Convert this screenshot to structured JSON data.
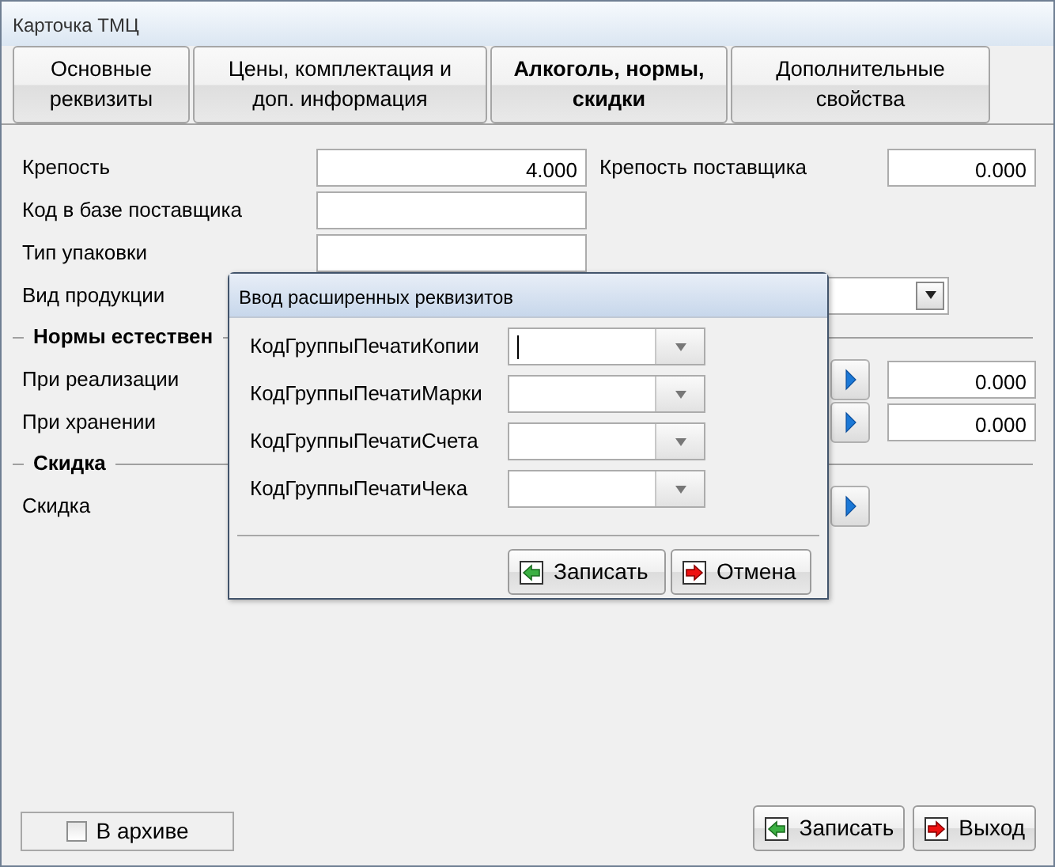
{
  "window": {
    "title": "Карточка ТМЦ"
  },
  "tabs": [
    {
      "label": "Основные реквизиты",
      "selected": false
    },
    {
      "label": "Цены, комплектация и доп.  информация",
      "selected": false
    },
    {
      "label": "Алкоголь, нормы, скидки",
      "selected": true
    },
    {
      "label": "Дополнительные свойства",
      "selected": false
    }
  ],
  "form": {
    "rows": [
      {
        "kind": "number",
        "label": "Крепость",
        "value": "4.000",
        "side": {
          "label": "Крепость поставщика",
          "value": "0.000"
        }
      },
      {
        "kind": "text",
        "label": "Код в базе поставщика"
      },
      {
        "kind": "text",
        "label": "Тип упаковки"
      },
      {
        "kind": "combo",
        "label": "Вид продукции"
      },
      {
        "kind": "section",
        "label": "Нормы естествен"
      },
      {
        "kind": "norm",
        "label": "При реализации",
        "value": "0.000"
      },
      {
        "kind": "norm",
        "label": "При хранении",
        "value": "0.000"
      },
      {
        "kind": "section",
        "label": "Скидка"
      },
      {
        "kind": "discount",
        "label": "Скидка"
      }
    ]
  },
  "archive": {
    "label": "В архиве",
    "checked": false
  },
  "buttons": [
    {
      "kind": "save",
      "label": "Записать"
    },
    {
      "kind": "exit",
      "label": "Выход"
    }
  ],
  "dialog": {
    "title": "Ввод расширенных реквизитов",
    "fields": [
      {
        "label": "КодГруппыПечатиКопии",
        "focused": true
      },
      {
        "label": "КодГруппыПечатиМарки",
        "focused": false
      },
      {
        "label": "КодГруппыПечатиСчета",
        "focused": false
      },
      {
        "label": "КодГруппыПечатиЧека",
        "focused": false
      }
    ],
    "buttons": [
      {
        "kind": "save",
        "label": "Записать"
      },
      {
        "kind": "cancel",
        "label": "Отмена"
      }
    ]
  }
}
